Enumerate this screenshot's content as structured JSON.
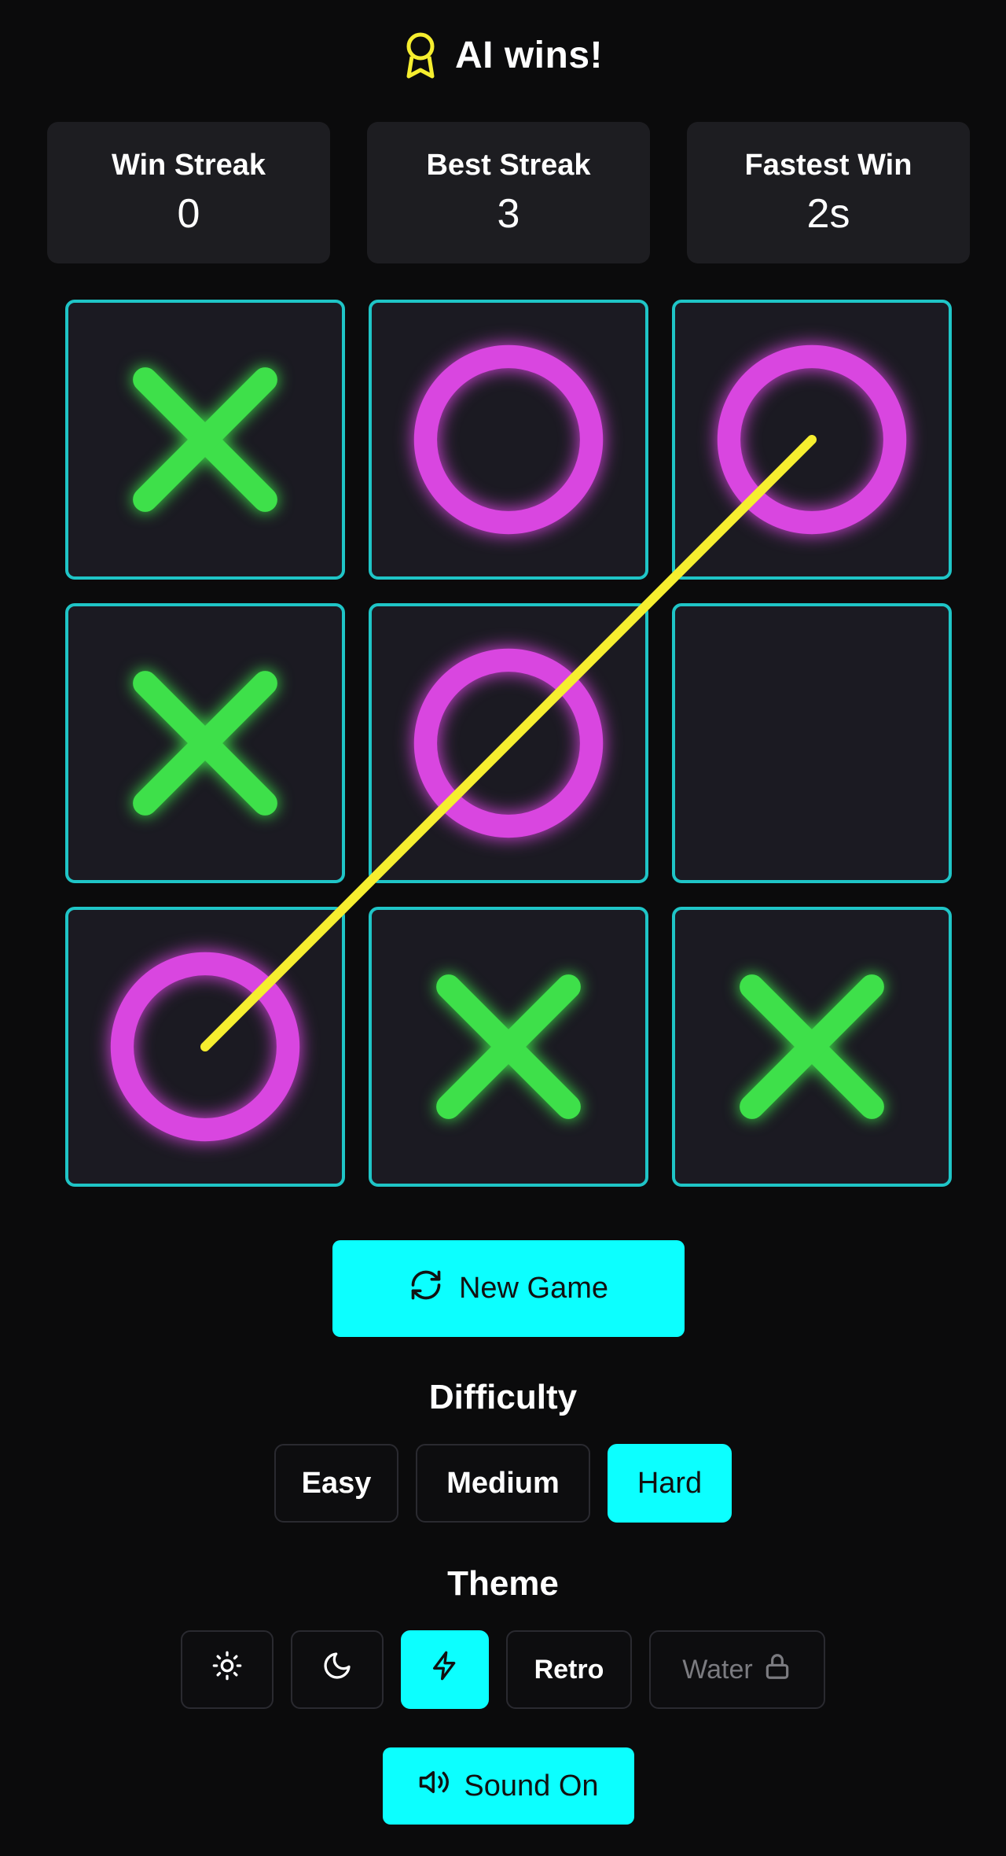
{
  "status": {
    "title": "AI wins!",
    "icon": "award-icon",
    "icon_color": "#f6ee2f"
  },
  "stats": [
    {
      "label": "Win Streak",
      "value": "0"
    },
    {
      "label": "Best Streak",
      "value": "3"
    },
    {
      "label": "Fastest Win",
      "value": "2s"
    }
  ],
  "board": {
    "cells": [
      "X",
      "O",
      "O",
      "X",
      "O",
      "",
      "O",
      "X",
      "X"
    ],
    "winning_cells": [
      6,
      4,
      2
    ],
    "colors": {
      "x": "#3ee04a",
      "o": "#d946e0",
      "cell_border": "#1fc5c7",
      "win_line": "#f6ee2f"
    }
  },
  "controls": {
    "new_game_label": "New Game",
    "new_game_icon": "refresh-icon",
    "accent": "#0cffff"
  },
  "difficulty": {
    "label": "Difficulty",
    "options": [
      "Easy",
      "Medium",
      "Hard"
    ],
    "selected": "Hard"
  },
  "theme": {
    "label": "Theme",
    "options": [
      {
        "icon": "sun-icon",
        "label": ""
      },
      {
        "icon": "moon-icon",
        "label": ""
      },
      {
        "icon": "lightning-icon",
        "label": "",
        "active": true
      },
      {
        "icon": "",
        "label": "Retro"
      },
      {
        "icon": "lock-icon",
        "label": "Water",
        "locked": true
      }
    ]
  },
  "sound": {
    "label": "Sound On",
    "icon": "speaker-icon"
  }
}
